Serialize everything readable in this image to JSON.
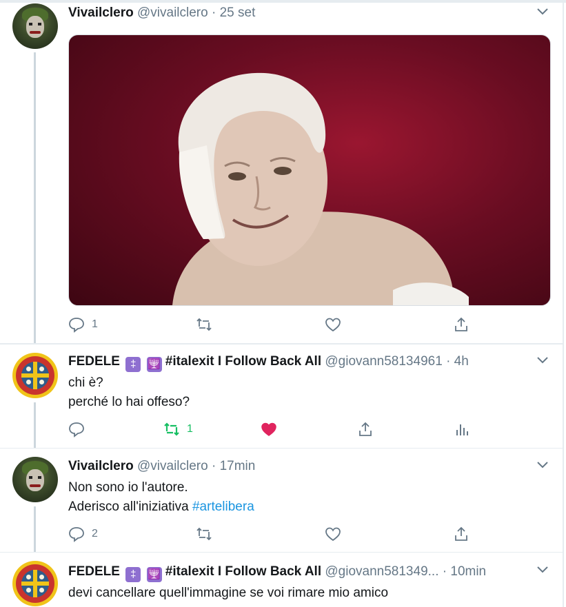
{
  "tweets": [
    {
      "name": "Vivailclero",
      "handle": "@vivailclero",
      "time": "25 set",
      "text_lines": [],
      "reply_count": "1",
      "retweet_count": "",
      "like_count": "",
      "has_media": true
    },
    {
      "name": "FEDELE",
      "name_emojis": [
        "‡",
        "🕎"
      ],
      "name_suffix": "#italexit I Follow Back All",
      "handle": "@giovann58134961",
      "time": "4h",
      "text_lines": [
        "chi è?",
        "perché lo hai offeso?"
      ],
      "reply_count": "",
      "retweet_count": "1",
      "like_count": ""
    },
    {
      "name": "Vivailclero",
      "handle": "@vivailclero",
      "time": "17min",
      "text_lines": [
        "Non sono io l'autore.",
        "Aderisco all'iniziativa"
      ],
      "hashtag": "#artelibera",
      "reply_count": "2",
      "retweet_count": "",
      "like_count": ""
    },
    {
      "name": "FEDELE",
      "name_emojis": [
        "‡",
        "🕎"
      ],
      "name_suffix": "#italexit I Follow Back All",
      "handle": "@giovann581349...",
      "time": "10min",
      "text_lines": [
        "devi cancellare quell'immagine se voi rimare mio amico"
      ]
    }
  ],
  "separator": "·",
  "colors": {
    "retweet_active": "#17bf63",
    "like_active": "#e0245e",
    "hashtag": "#1b95e0",
    "emoji_box": "#8e6fd0"
  },
  "icons": {
    "reply": "reply-icon",
    "retweet": "retweet-icon",
    "like": "heart-icon",
    "share": "share-icon",
    "analytics": "analytics-icon",
    "more": "chevron-down-icon"
  }
}
